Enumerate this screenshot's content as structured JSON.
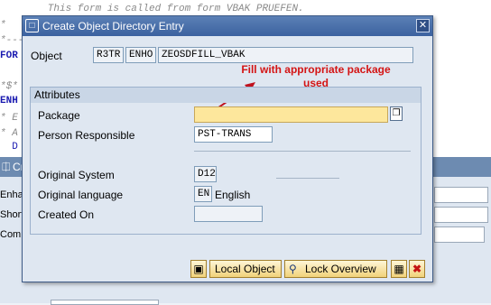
{
  "editor": {
    "lines": [
      {
        "text": "        This form is called from form VBAK PRUEFEN.",
        "style": "comment"
      },
      {
        "text": "*",
        "style": "comment"
      },
      {
        "text": "*---",
        "style": "comment"
      },
      {
        "text": "FOR",
        "style": "kw"
      },
      {
        "text": "",
        "style": "plain"
      },
      {
        "text": "*$*",
        "style": "comment"
      },
      {
        "text": "ENH",
        "style": "kw"
      },
      {
        "text": "* E",
        "style": "comment"
      },
      {
        "text": "* A",
        "style": "comment"
      },
      {
        "text": "  D",
        "style": "kw"
      }
    ],
    "panel_title": "Cre",
    "labels": [
      "Enhar",
      "Short",
      "Comp"
    ]
  },
  "dialog": {
    "title": "Create Object Directory Entry",
    "close_icon": "close-icon",
    "object_label": "Object",
    "object_values": [
      "R3TR",
      "ENHO",
      "ZEOSDFILL_VBAK"
    ],
    "annotation": "Fill with appropriate package used",
    "group_title": "Attributes",
    "package_label": "Package",
    "package_value": "",
    "person_label": "Person Responsible",
    "person_value": "PST-TRANS",
    "original_system_label": "Original System",
    "original_system_value": "D12",
    "original_language_label": "Original language",
    "original_language_value": "EN",
    "original_language_text": "English",
    "created_on_label": "Created On",
    "created_on_value": "",
    "buttons": {
      "local_object": "Local Object",
      "lock_overview": "Lock Overview"
    }
  }
}
